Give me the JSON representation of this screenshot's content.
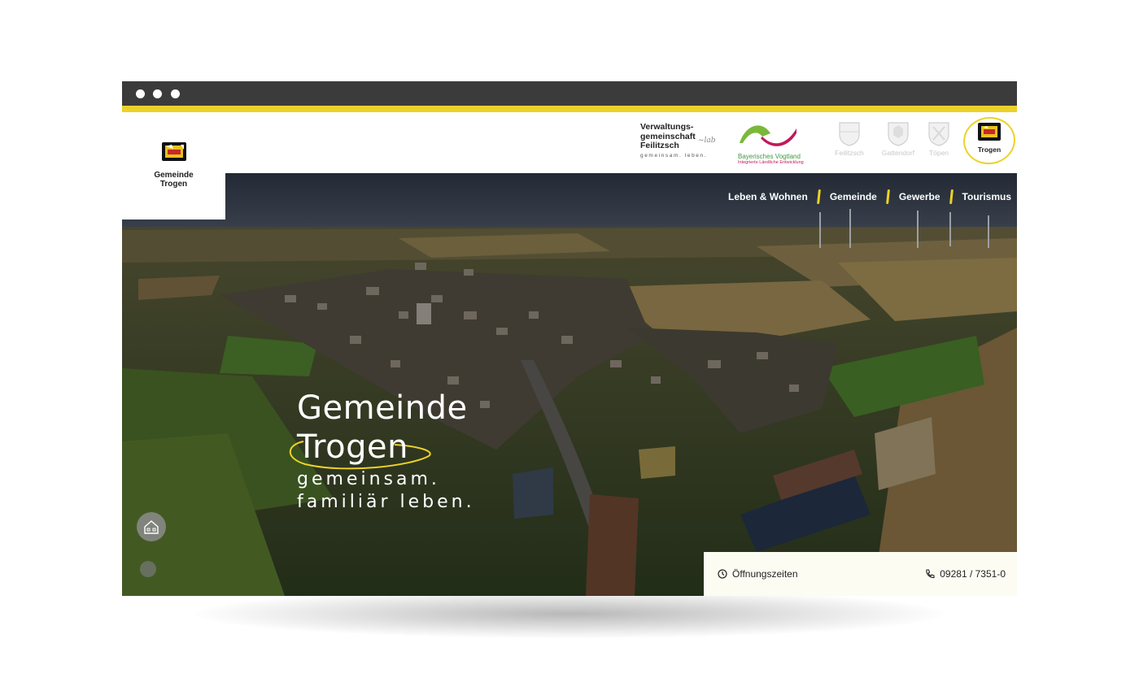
{
  "window": {
    "controls": [
      "dot",
      "dot",
      "dot"
    ]
  },
  "colors": {
    "accent": "#ecd228",
    "chrome": "#3b3b3b",
    "info_bg": "#fdfcf3"
  },
  "site_logo": {
    "line1": "Gemeinde",
    "line2": "Trogen",
    "icon": "trogen-crest-icon"
  },
  "partners": {
    "vg": {
      "line1": "Verwaltungs-",
      "line2": "gemeinschaft",
      "line3": "Feilitzsch",
      "slogan": "gemeinsam. leben."
    },
    "bv": {
      "name": "Bayerisches Vogtland",
      "sub": "Integrierte Ländliche Entwicklung"
    }
  },
  "municipalities": [
    {
      "label": "Feilitzsch",
      "active": false
    },
    {
      "label": "Gattendorf",
      "active": false
    },
    {
      "label": "Töpen",
      "active": false
    },
    {
      "label": "Trogen",
      "active": true
    }
  ],
  "nav": [
    "Leben & Wohnen",
    "Gemeinde",
    "Gewerbe",
    "Tourismus"
  ],
  "hero": {
    "title_line1": "Gemeinde",
    "title_line2": "Trogen",
    "tagline_line1": "gemeinsam.",
    "tagline_line2": "familiär leben."
  },
  "info": {
    "hours_label": "Öffnungszeiten",
    "phone": "09281 / 7351-0"
  }
}
